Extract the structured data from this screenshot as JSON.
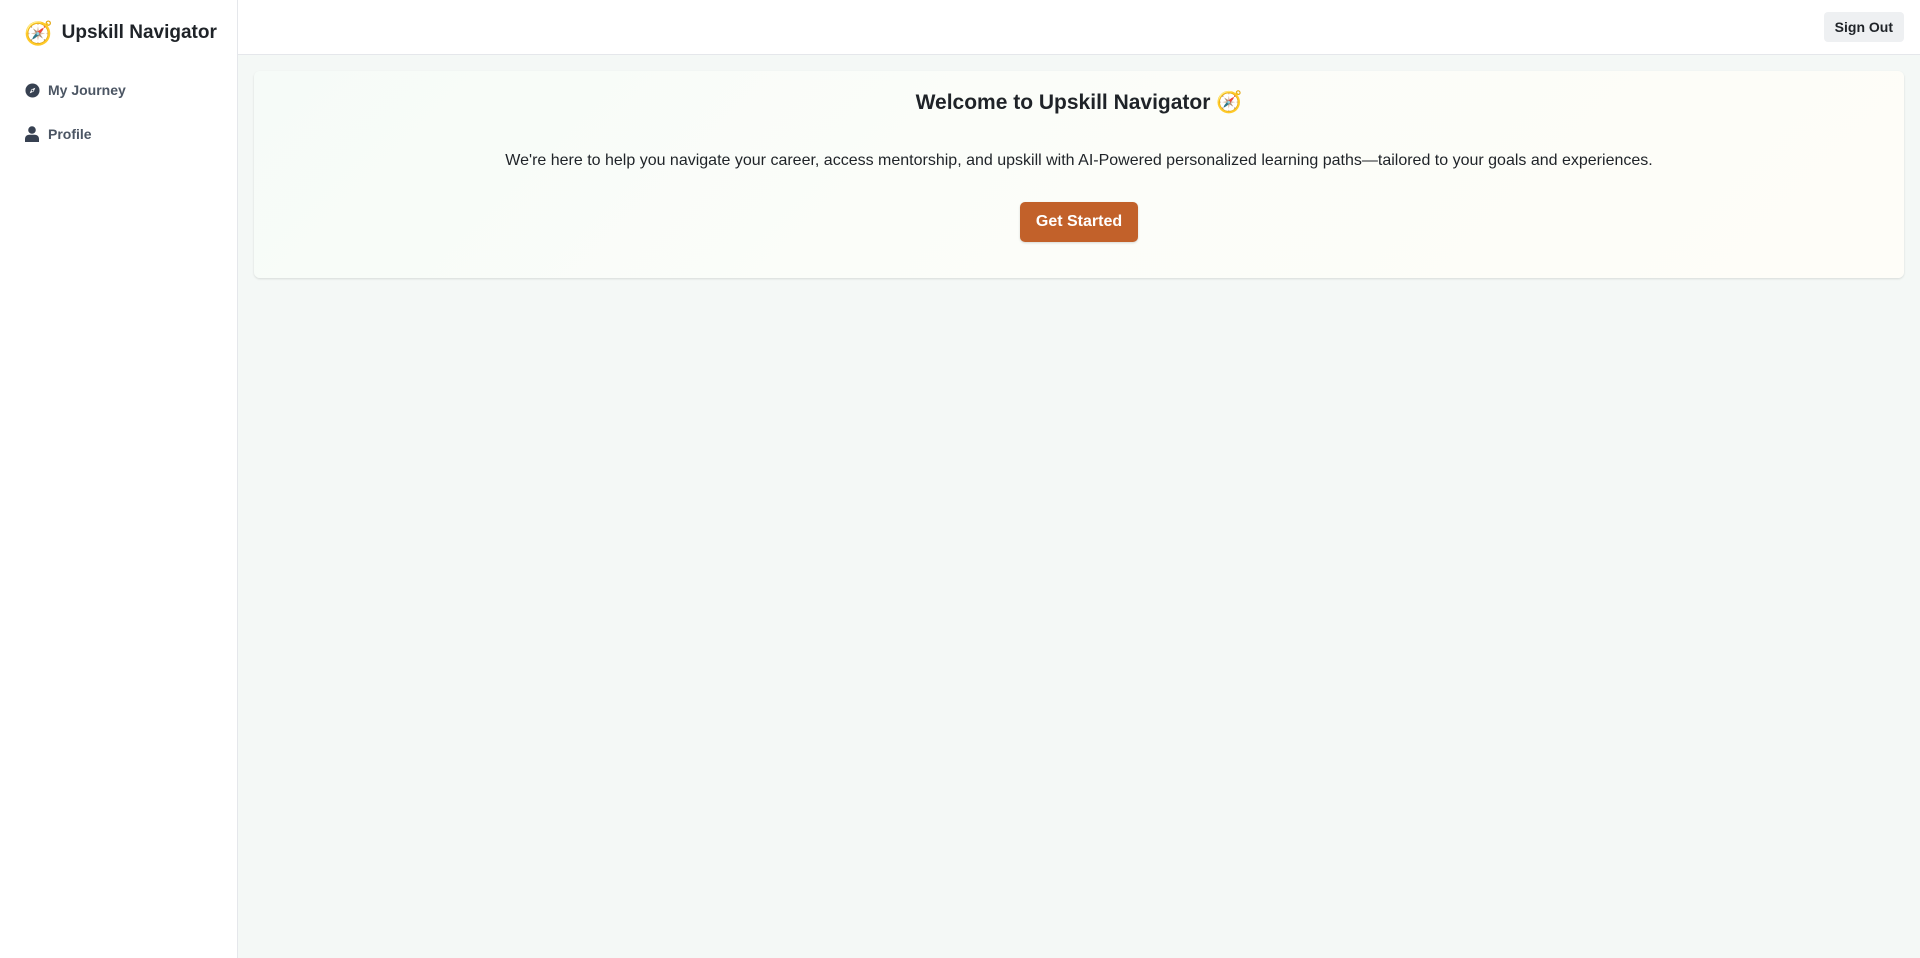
{
  "brand": {
    "icon": "compass-emoji",
    "icon_glyph": "🧭",
    "title": "Upskill Navigator"
  },
  "sidebar": {
    "items": [
      {
        "icon": "compass-icon",
        "label": "My Journey"
      },
      {
        "icon": "user-icon",
        "label": "Profile"
      }
    ]
  },
  "topbar": {
    "sign_out_label": "Sign Out"
  },
  "welcome": {
    "title": "Welcome to Upskill Navigator 🧭",
    "description": "We're here to help you navigate your career, access mentorship, and upskill with AI-Powered personalized learning paths—tailored to your goals and experiences.",
    "cta_label": "Get Started"
  },
  "colors": {
    "accent": "#c2612a",
    "background": "#f4f8f6",
    "nav_text": "#4b5563"
  }
}
